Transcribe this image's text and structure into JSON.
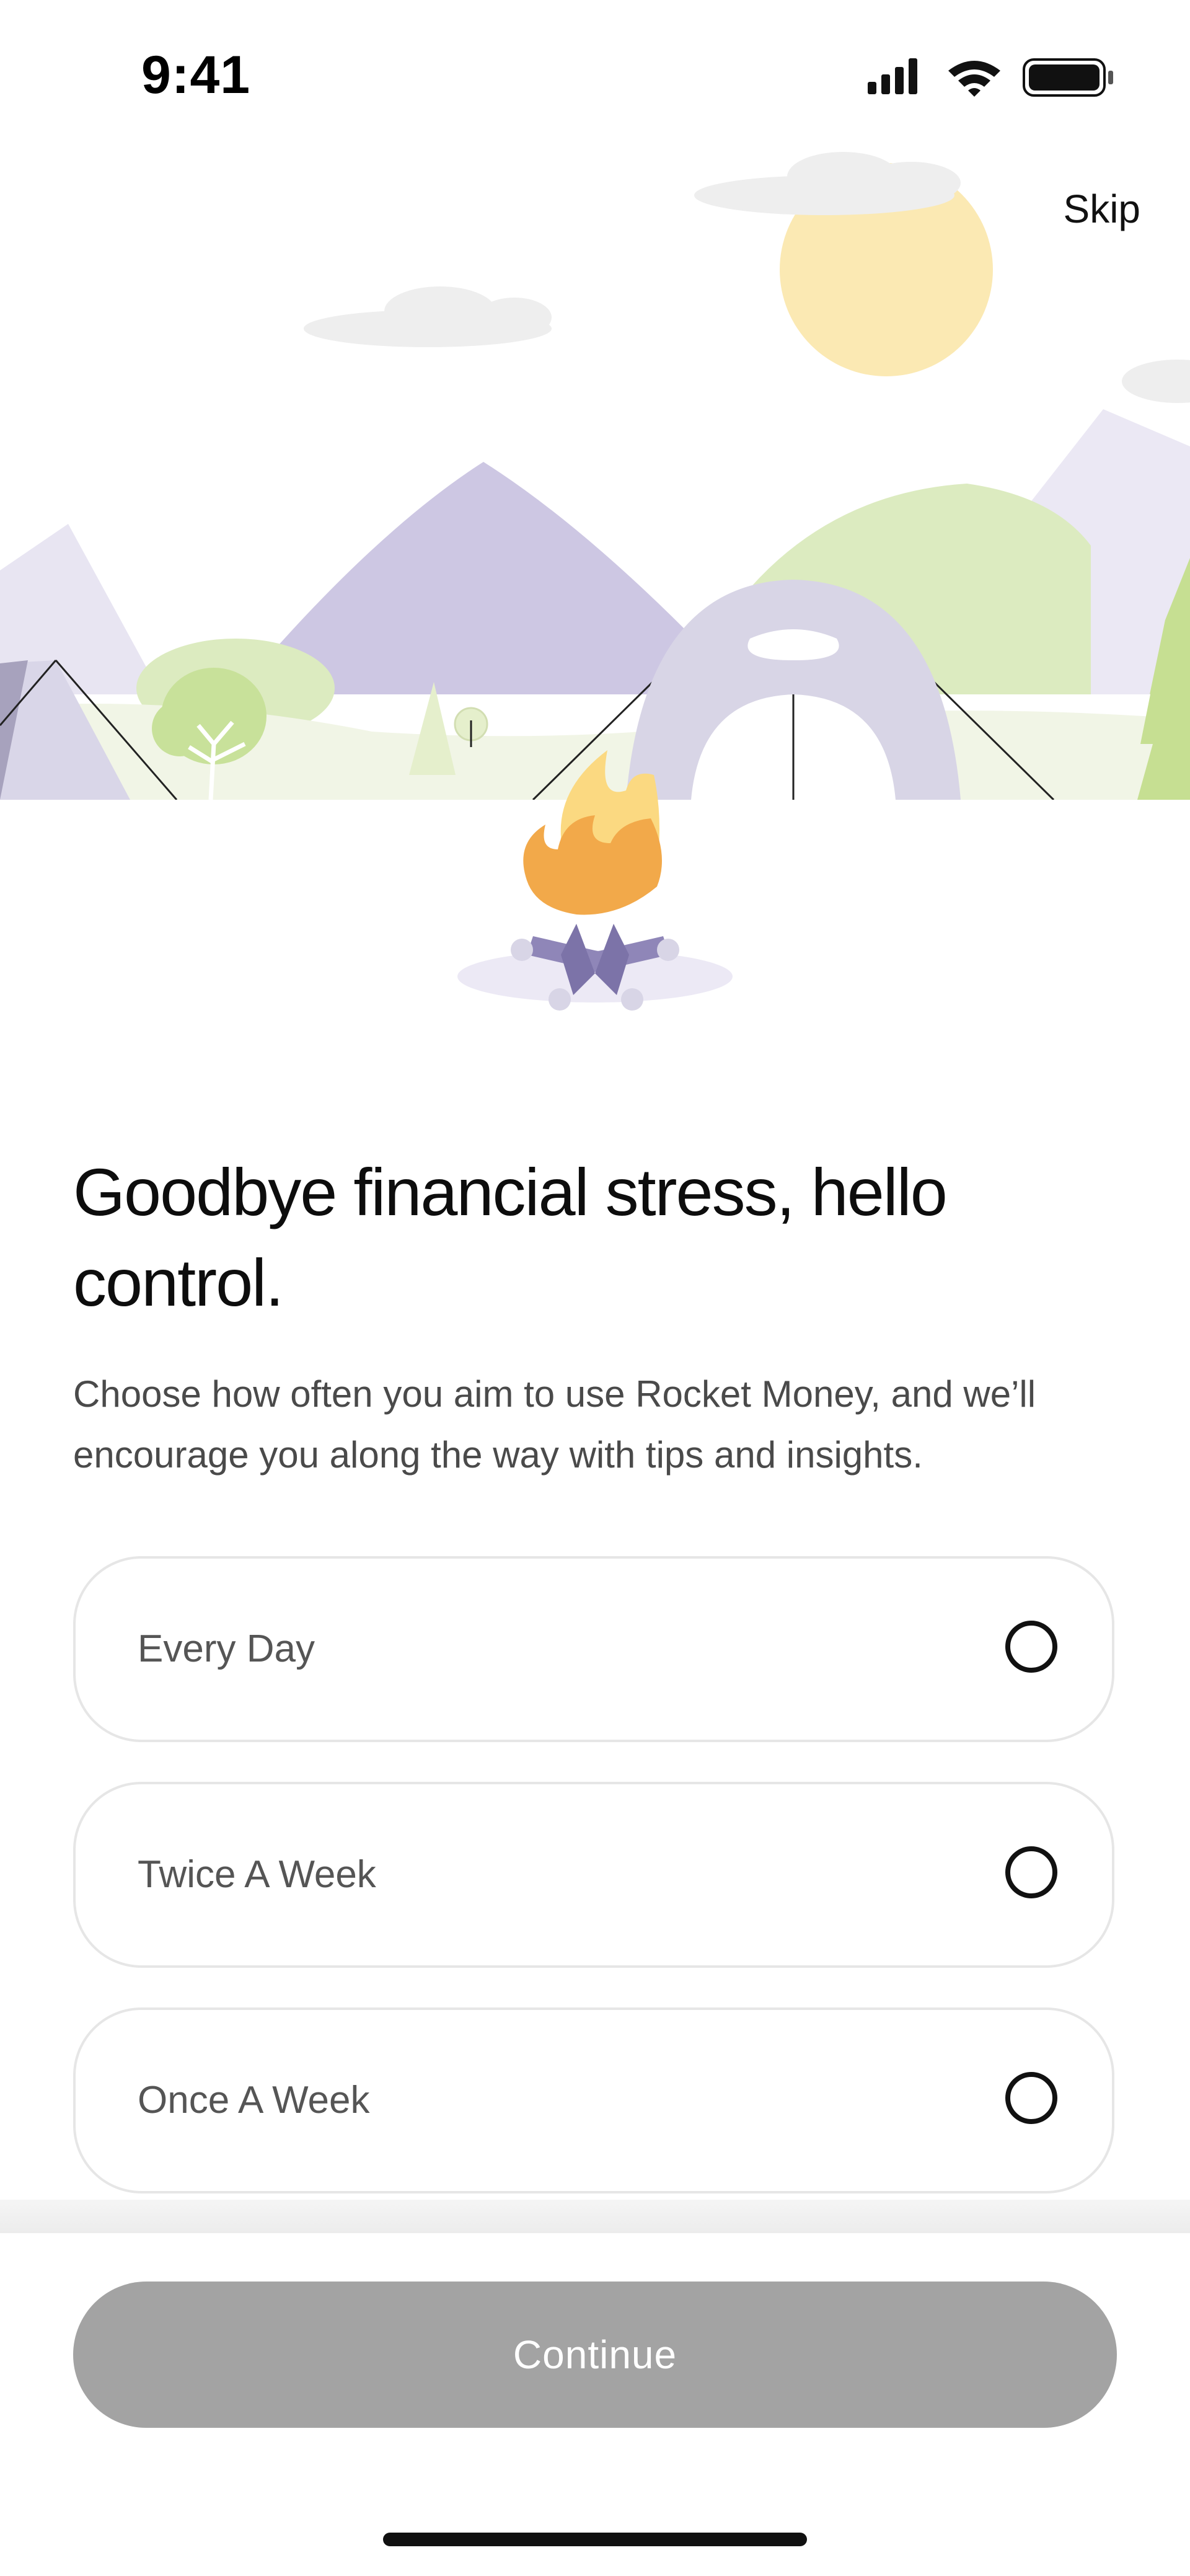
{
  "status_bar": {
    "time": "9:41"
  },
  "header": {
    "skip_label": "Skip"
  },
  "content": {
    "headline": "Goodbye financial stress, hello control.",
    "description": "Choose how often you aim to use Rocket Money, and we’ll encourage you along the way with tips and insights."
  },
  "options": [
    {
      "label": "Every Day",
      "selected": false
    },
    {
      "label": "Twice A Week",
      "selected": false
    },
    {
      "label": "Once A Week",
      "selected": false
    }
  ],
  "footer": {
    "continue_label": "Continue",
    "continue_enabled": false
  },
  "colors": {
    "button_disabled": "#a3a3a3",
    "mountain_purple": "#cdc7e3",
    "hill_green": "#dcebc0",
    "sun_yellow": "#fbe9b3",
    "fire_orange": "#f2a94a"
  },
  "icons": [
    "signal-icon",
    "wifi-icon",
    "battery-icon",
    "radio-unchecked-icon"
  ]
}
